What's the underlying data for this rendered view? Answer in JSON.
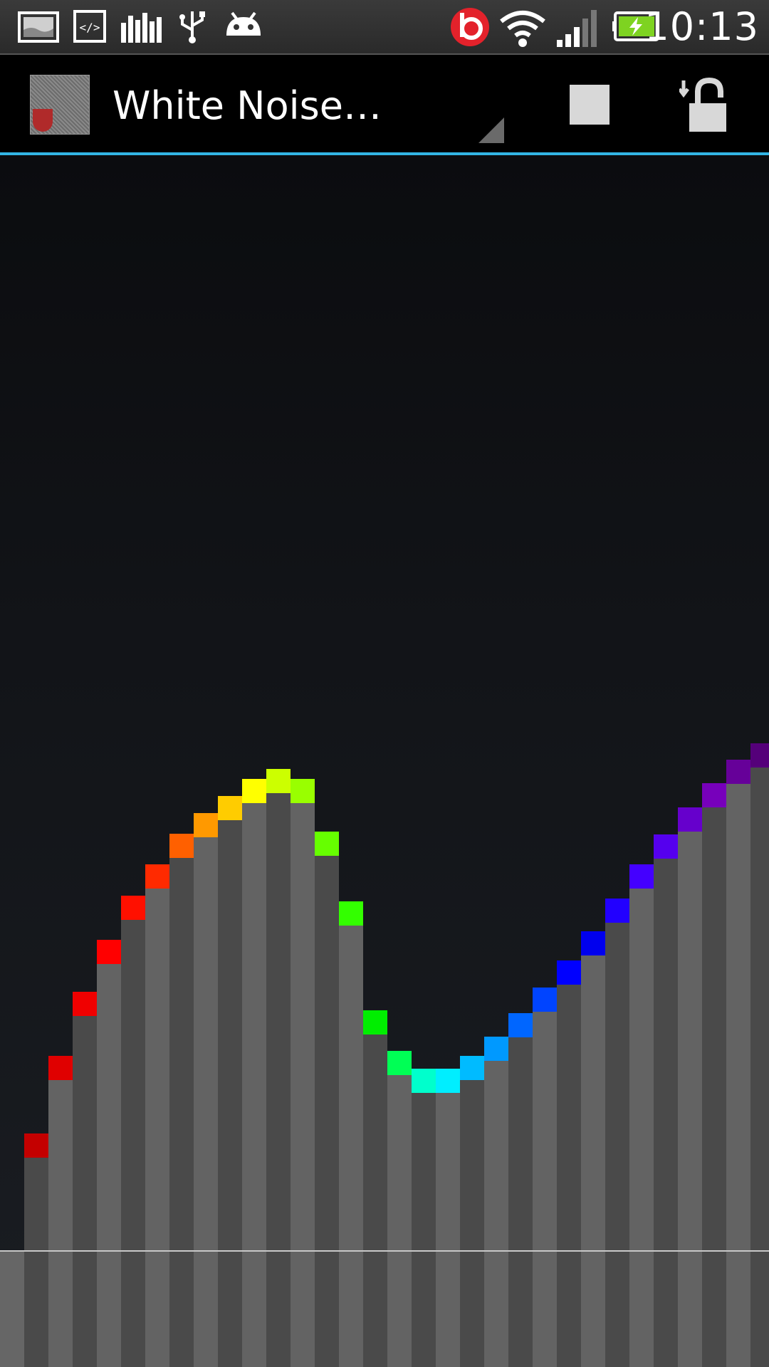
{
  "status_bar": {
    "time": "10:13",
    "icons": [
      "gallery-icon",
      "code-icon",
      "equalizer-icon",
      "usb-icon",
      "android-icon",
      "beats-icon",
      "wifi-icon",
      "signal-icon",
      "battery-charging-icon"
    ]
  },
  "action_bar": {
    "title": "White Noise…",
    "accent": "#33b5e5"
  },
  "visualizer": {
    "bar_heights": [
      130,
      239,
      329,
      402,
      464,
      508,
      551,
      580,
      604,
      628,
      642,
      628,
      554,
      456,
      303,
      246,
      221,
      221,
      239,
      266,
      299,
      335,
      373,
      414,
      460,
      508,
      550,
      588,
      622,
      655,
      678,
      646
    ],
    "cap_colors": [
      "#c40000",
      "#e00000",
      "#f00000",
      "#ff0000",
      "#ff1000",
      "#ff2a00",
      "#ff6000",
      "#ff9900",
      "#ffcc00",
      "#ffff00",
      "#ccff00",
      "#99ff00",
      "#66ff00",
      "#33ff00",
      "#00ee00",
      "#00ff55",
      "#00ffcc",
      "#00eeff",
      "#00bbff",
      "#0099ff",
      "#0066ff",
      "#0044ff",
      "#0000ff",
      "#0000ee",
      "#2200ff",
      "#4400ff",
      "#5500ee",
      "#6600cc",
      "#7700bb",
      "#660099",
      "#55007a",
      "#4a006a"
    ]
  }
}
